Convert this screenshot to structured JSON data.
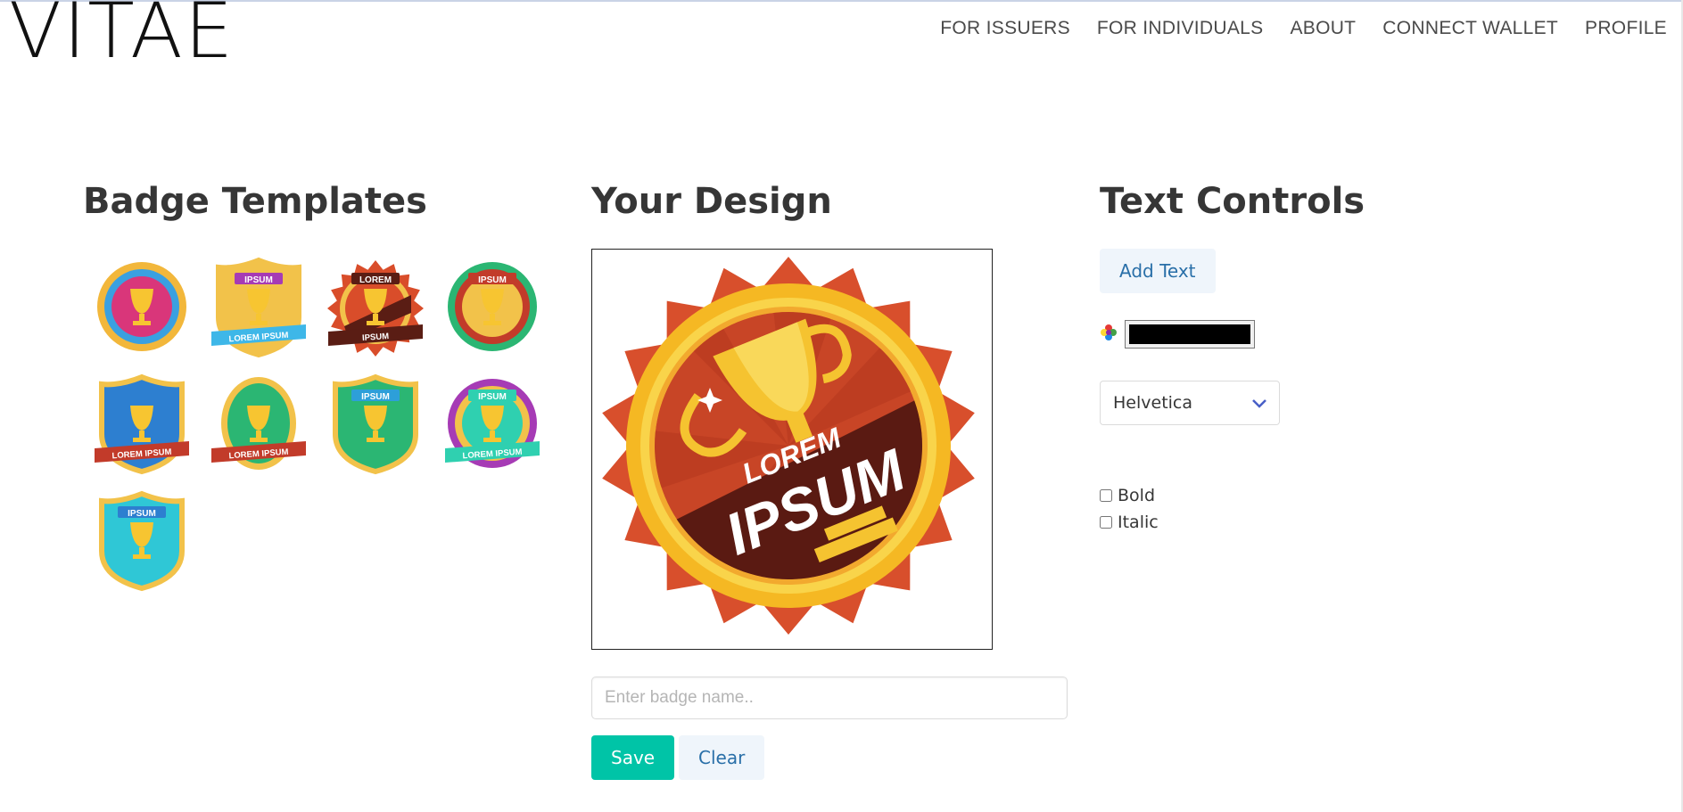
{
  "header": {
    "logo": "VITAE",
    "nav": [
      "FOR ISSUERS",
      "FOR INDIVIDUALS",
      "ABOUT",
      "CONNECT WALLET",
      "PROFILE"
    ]
  },
  "templates": {
    "title": "Badge Templates",
    "badges": [
      {
        "ribbon_top": "",
        "ribbon_bottom": "",
        "shape": "round-scalloped",
        "colors": [
          "#f2b73b",
          "#3aa0e0",
          "#d9367a"
        ]
      },
      {
        "ribbon_top": "IPSUM",
        "ribbon_bottom": "LOREM IPSUM",
        "shape": "shield",
        "colors": [
          "#f2c24a",
          "#a63bb5",
          "#3eb7e8"
        ]
      },
      {
        "ribbon_top": "LOREM",
        "ribbon_bottom": "IPSUM",
        "shape": "star-burst",
        "colors": [
          "#d94d2a",
          "#f2c24a",
          "#5a1d14"
        ]
      },
      {
        "ribbon_top": "IPSUM",
        "ribbon_bottom": "",
        "shape": "round-green-rim",
        "colors": [
          "#2bb673",
          "#c23b2a",
          "#f2c24a"
        ]
      },
      {
        "ribbon_top": "",
        "ribbon_bottom": "LOREM IPSUM",
        "shape": "shield-blue",
        "colors": [
          "#2d7fd0",
          "#f2c24a",
          "#c23b2a"
        ]
      },
      {
        "ribbon_top": "",
        "ribbon_bottom": "LOREM IPSUM",
        "shape": "oval-green",
        "colors": [
          "#2bb673",
          "#f2c24a",
          "#c23b2a"
        ]
      },
      {
        "ribbon_top": "IPSUM",
        "ribbon_bottom": "",
        "shape": "shield-green",
        "colors": [
          "#2bb673",
          "#2d9fd9",
          "#f2c24a"
        ]
      },
      {
        "ribbon_top": "IPSUM",
        "ribbon_bottom": "LOREM IPSUM",
        "shape": "round-purple",
        "colors": [
          "#a63bb5",
          "#f2c24a",
          "#2fd0b0"
        ]
      },
      {
        "ribbon_top": "IPSUM",
        "ribbon_bottom": "",
        "shape": "shield-cyan",
        "colors": [
          "#2fc7d6",
          "#f2c24a",
          "#2d7fd0"
        ]
      }
    ]
  },
  "design": {
    "title": "Your Design",
    "badge_text_top": "LOREM",
    "badge_text_bottom": "IPSUM",
    "name_placeholder": "Enter badge name..",
    "save_label": "Save",
    "clear_label": "Clear"
  },
  "controls": {
    "title": "Text Controls",
    "add_text_label": "Add Text",
    "color_value": "#000000",
    "font_selected": "Helvetica",
    "bold_label": "Bold",
    "italic_label": "Italic"
  }
}
